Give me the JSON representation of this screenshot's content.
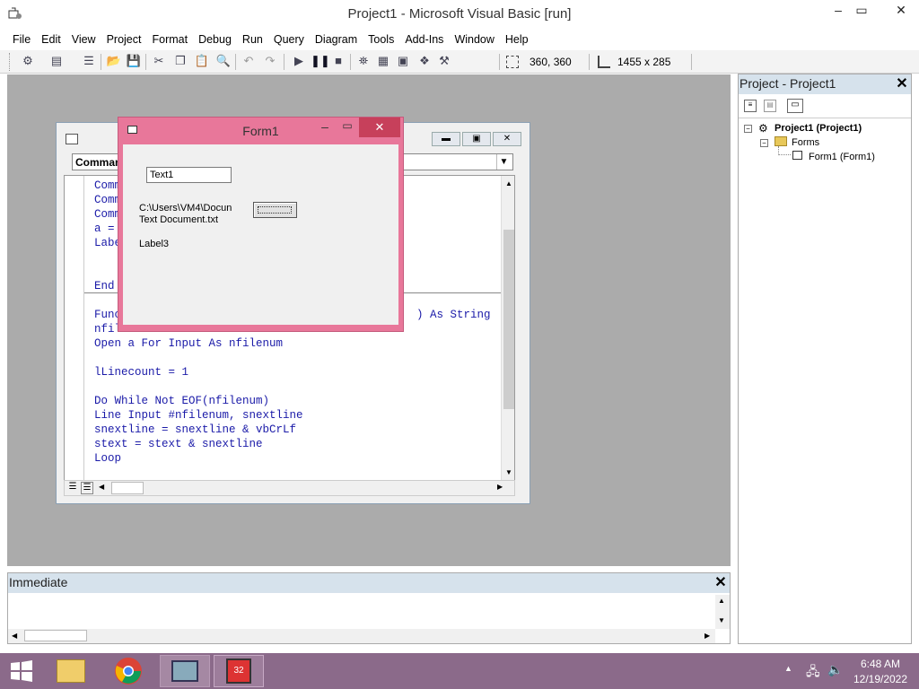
{
  "window": {
    "title": "Project1 - Microsoft Visual Basic [run]"
  },
  "menu": [
    "File",
    "Edit",
    "View",
    "Project",
    "Format",
    "Debug",
    "Run",
    "Query",
    "Diagram",
    "Tools",
    "Add-Ins",
    "Window",
    "Help"
  ],
  "toolbar": {
    "position": "360, 360",
    "size": "1455 x 285"
  },
  "code_window": {
    "object_combo": "Comman",
    "lines": [
      "Comm",
      "Comm",
      "Comm",
      "a =",
      "Labe",
      "",
      "",
      "End",
      "",
      "Func",
      ") As String",
      "nfil",
      "Open a For Input As nfilenum",
      "",
      "lLinecount = 1",
      "",
      "Do While Not EOF(nfilenum)",
      "Line Input #nfilenum, snextline",
      "snextline = snextline & vbCrLf",
      "stext = stext & snextline",
      "Loop"
    ]
  },
  "form1": {
    "title": "Form1",
    "text1": "Text1",
    "path_label_line1": "C:\\Users\\VM4\\Docun",
    "path_label_line2": "Text Document.txt",
    "label3": "Label3"
  },
  "project_panel": {
    "title": "Project - Project1",
    "root": "Project1 (Project1)",
    "folder": "Forms",
    "item": "Form1 (Form1)"
  },
  "immediate": {
    "title": "Immediate"
  },
  "clock": {
    "time": "6:48 AM",
    "date": "12/19/2022"
  },
  "colors": {
    "form_border": "#e8779a",
    "code_text": "#1a1aa8",
    "mdi_bg": "#ababab",
    "taskbar": "#8b6a8a"
  }
}
